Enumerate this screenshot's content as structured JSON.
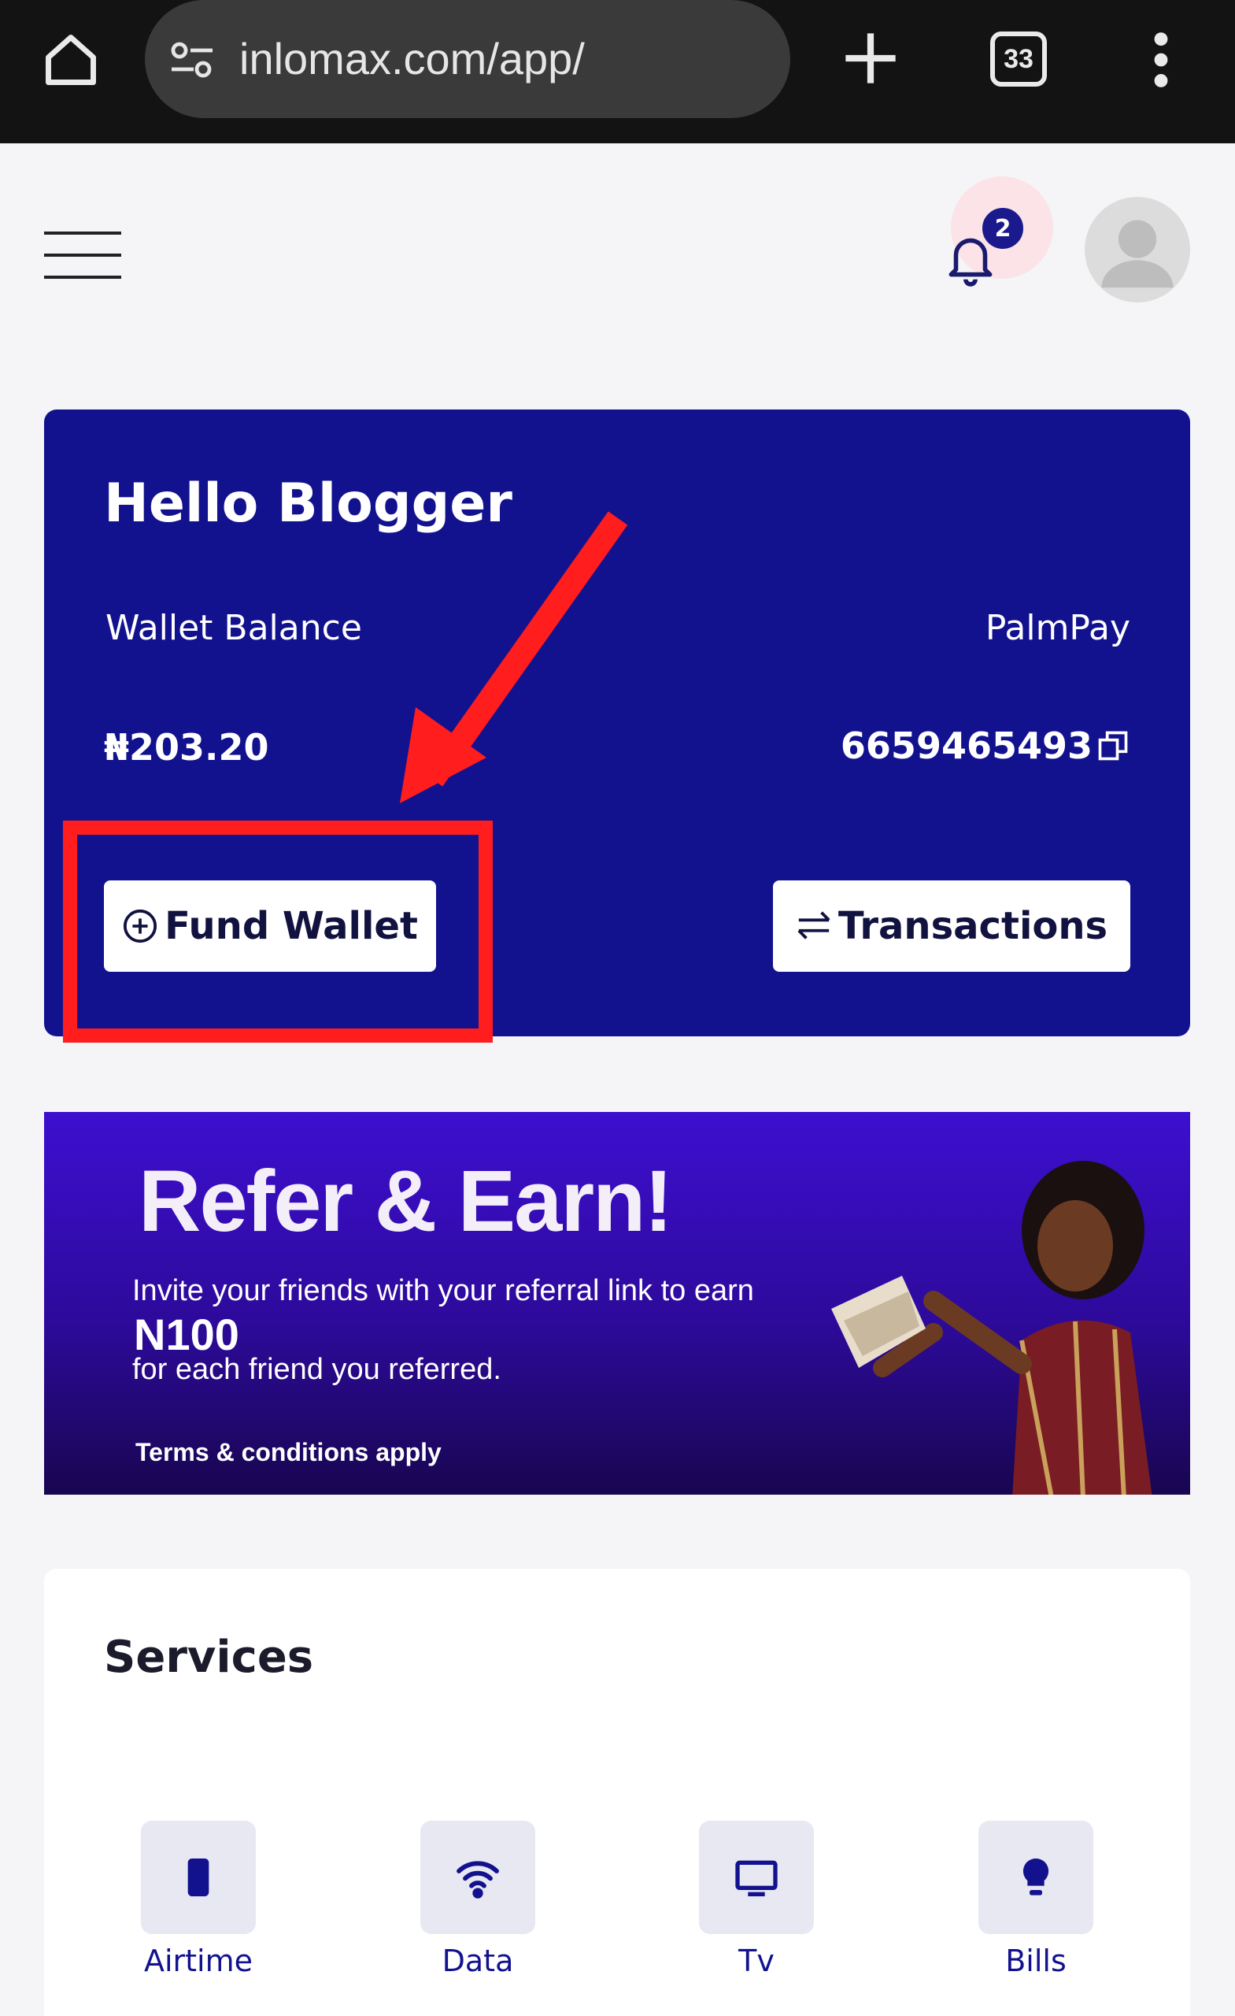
{
  "browser": {
    "url": "inlomax.com/app/",
    "tab_count": "33"
  },
  "header": {
    "notification_count": "2"
  },
  "wallet": {
    "greeting": "Hello Blogger",
    "balance_label": "Wallet Balance",
    "bank_name": "PalmPay",
    "balance": "₦203.20",
    "account_number": "6659465493",
    "fund_button": "Fund Wallet",
    "transactions_button": "Transactions"
  },
  "promo": {
    "title": "Refer & Earn!",
    "line1": "Invite your friends with your referral link to earn",
    "amount": "N100",
    "line2": "for each friend you referred.",
    "terms": "Terms & conditions apply"
  },
  "services": {
    "heading": "Services",
    "items": [
      {
        "label": "Airtime",
        "icon": "phone-icon"
      },
      {
        "label": "Data",
        "icon": "wifi-icon"
      },
      {
        "label": "Tv",
        "icon": "monitor-icon"
      },
      {
        "label": "Bills",
        "icon": "bulb-icon"
      }
    ]
  },
  "colors": {
    "brand": "#12128f",
    "annotation": "#ff1d1d",
    "chrome": "#131313"
  }
}
